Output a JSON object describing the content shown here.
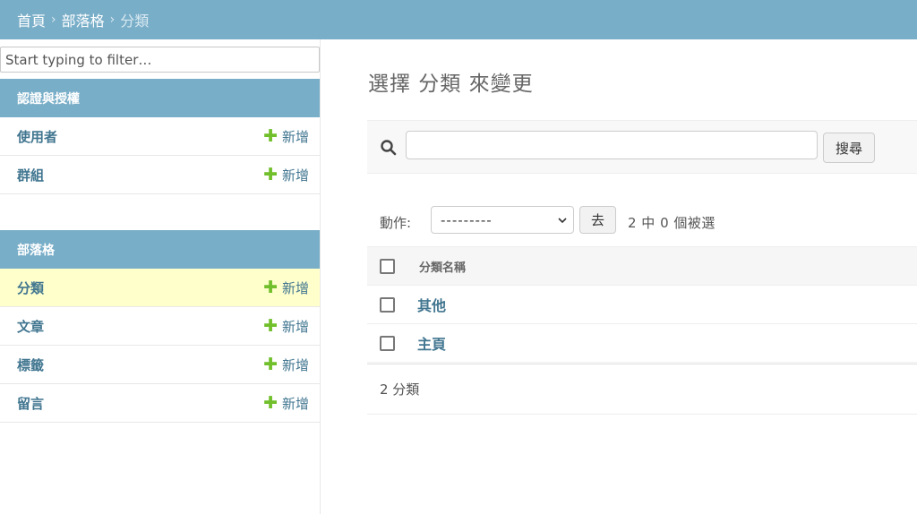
{
  "breadcrumbs": {
    "home": "首頁",
    "app": "部落格",
    "current": "分類",
    "separator": "›"
  },
  "sidebar": {
    "filter_placeholder": "Start typing to filter…",
    "modules": [
      {
        "caption": "認證與授權",
        "models": [
          {
            "name": "使用者",
            "add_label": "新增"
          },
          {
            "name": "群組",
            "add_label": "新增"
          }
        ]
      },
      {
        "caption": "部落格",
        "models": [
          {
            "name": "分類",
            "add_label": "新增",
            "current": true
          },
          {
            "name": "文章",
            "add_label": "新增"
          },
          {
            "name": "標籤",
            "add_label": "新增"
          },
          {
            "name": "留言",
            "add_label": "新增"
          }
        ]
      }
    ]
  },
  "main": {
    "title": "選擇 分類 來變更",
    "search": {
      "value": "",
      "button_label": "搜尋",
      "icon": "search-icon"
    },
    "actions": {
      "label": "動作:",
      "selected_option": "---------",
      "go_label": "去",
      "counter": "2 中 0 個被選"
    },
    "results": {
      "column_header": "分類名稱",
      "rows": [
        {
          "name": "其他"
        },
        {
          "name": "主頁"
        }
      ]
    },
    "paginator": "2 分類"
  },
  "colors": {
    "header_bg": "#79aec8",
    "link": "#417690",
    "add_icon": "#70bf2b",
    "current_row_bg": "#ffffcc"
  }
}
